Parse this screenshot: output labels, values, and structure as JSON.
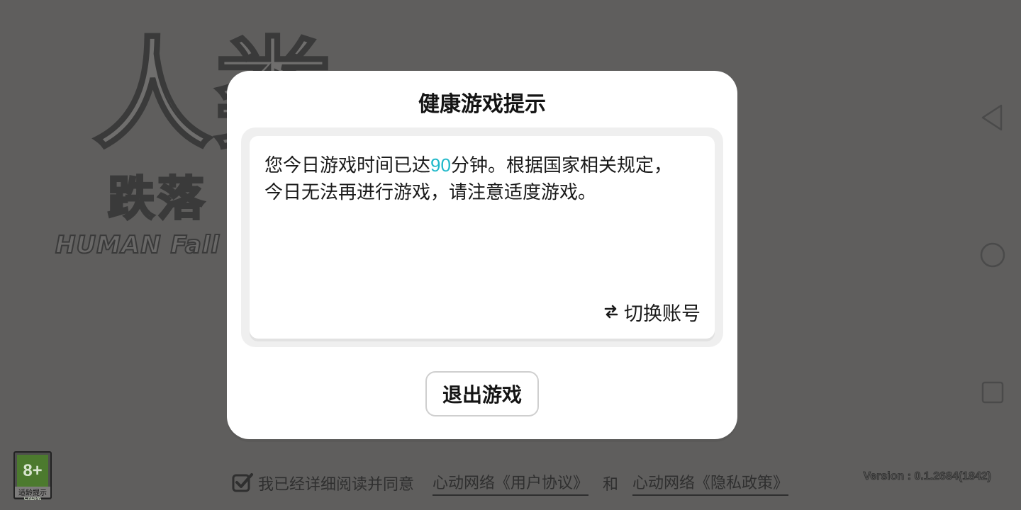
{
  "background": {
    "logo_main": "人类",
    "logo_sub": "跌落",
    "logo_en": "HUMAN Fall Flat",
    "rating": {
      "age": "8+",
      "org": "CADPA",
      "label": "适龄提示"
    },
    "agreement": {
      "prefix": "我已经详细阅读并同意",
      "user_agreement": "心动网络《用户协议》",
      "and": "和",
      "privacy_policy": "心动网络《隐私政策》"
    },
    "version": "Version : 0.1.2684(1842)"
  },
  "nav_buttons": [
    "back-icon",
    "home-icon",
    "recents-icon"
  ],
  "dialog": {
    "title": "健康游戏提示",
    "message_before": "您今日游戏时间已达",
    "minutes": "90",
    "message_after": "分钟。根据国家相关规定，今日无法再进行游戏，请注意适度游戏。",
    "switch_account": "切换账号",
    "exit_button": "退出游戏"
  },
  "colors": {
    "overlay_background": "#5f5e5d",
    "highlight": "#1fb8c9",
    "dialog_background": "#ffffff"
  }
}
